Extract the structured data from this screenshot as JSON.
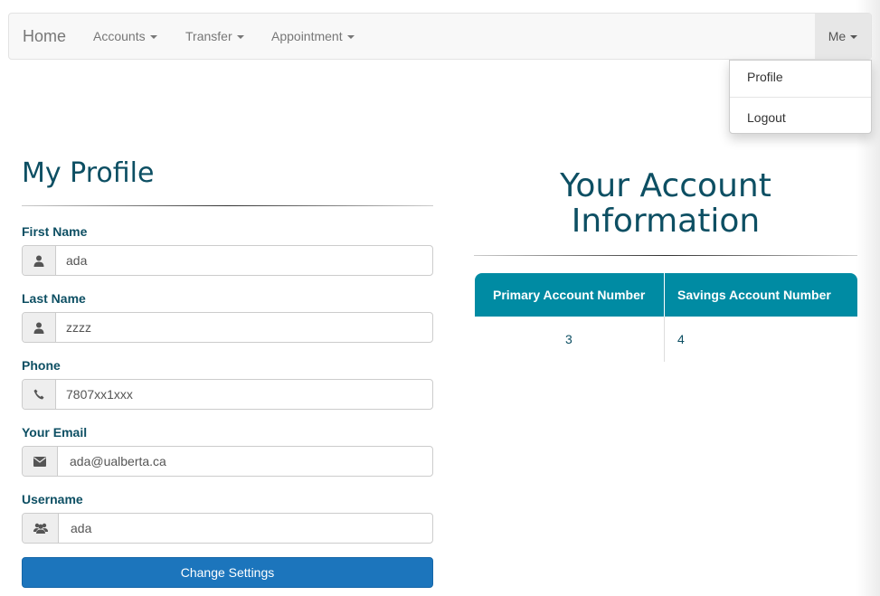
{
  "navbar": {
    "brand": "Home",
    "items": [
      {
        "label": "Accounts"
      },
      {
        "label": "Transfer"
      },
      {
        "label": "Appointment"
      }
    ],
    "user_menu": {
      "label": "Me",
      "items": [
        {
          "label": "Profile"
        },
        {
          "label": "Logout"
        }
      ]
    }
  },
  "profile": {
    "title": "My Profile",
    "fields": [
      {
        "label": "First Name",
        "value": "ada",
        "icon": "user-icon"
      },
      {
        "label": "Last Name",
        "value": "zzzz",
        "icon": "user-icon"
      },
      {
        "label": "Phone",
        "value": "7807xx1xxx",
        "icon": "phone-icon"
      },
      {
        "label": "Your Email",
        "value": "ada@ualberta.ca",
        "icon": "envelope-icon"
      },
      {
        "label": "Username",
        "value": "ada",
        "icon": "users-icon"
      }
    ],
    "submit_label": "Change Settings"
  },
  "account": {
    "title_line1": "Your Account",
    "title_line2": "Information",
    "columns": [
      "Primary Account Number",
      "Savings Account Number"
    ],
    "rows": [
      [
        "3",
        "4"
      ]
    ]
  },
  "colors": {
    "heading": "#0d4f63",
    "table_header": "#008ba3",
    "button": "#1c75bc"
  }
}
